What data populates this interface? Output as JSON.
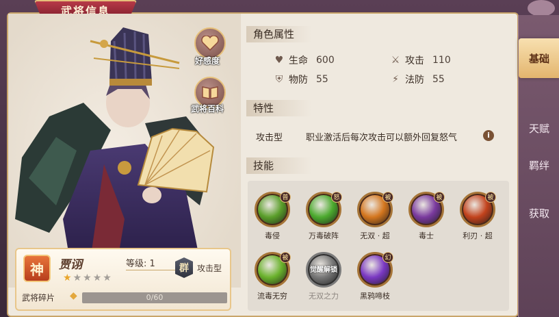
{
  "header": {
    "title": "武将信息"
  },
  "tabs": [
    {
      "label": "基础",
      "active": true
    },
    {
      "label": "天赋",
      "active": false
    },
    {
      "label": "羁绊",
      "active": false
    },
    {
      "label": "获取",
      "active": false
    }
  ],
  "side_buttons": {
    "favor_label": "好感度",
    "encyclopedia_label": "武将百科"
  },
  "hero": {
    "rank_badge": "神",
    "name": "贾诩",
    "level_text": "等级: 1",
    "faction_badge": "群",
    "type": "攻击型",
    "stars_filled": 1,
    "stars_total": 5,
    "star_glyph": "★"
  },
  "fragments": {
    "label": "武将碎片",
    "progress_text": "0/60",
    "current": 0,
    "required": 60
  },
  "attributes": {
    "heading": "角色属性",
    "hp_label": "生命",
    "hp_value": "600",
    "atk_label": "攻击",
    "atk_value": "110",
    "pdef_label": "物防",
    "pdef_value": "55",
    "mdef_label": "法防",
    "mdef_value": "55"
  },
  "trait": {
    "heading": "特性",
    "type": "攻击型",
    "description": "职业激活后每次攻击可以额外回复怒气",
    "info_glyph": "i"
  },
  "skills": {
    "heading": "技能",
    "items": [
      {
        "name": "毒侵",
        "badge": "普",
        "locked": false,
        "color": "#5a9e2a"
      },
      {
        "name": "万毒破阵",
        "badge": "怒",
        "locked": false,
        "color": "#4caa2e"
      },
      {
        "name": "无双 · 超",
        "badge": "被",
        "locked": false,
        "color": "#d4761e"
      },
      {
        "name": "毒士",
        "badge": "被",
        "locked": false,
        "color": "#7a3a9e"
      },
      {
        "name": "利刃 · 超",
        "badge": "被",
        "locked": false,
        "color": "#c2421c"
      },
      {
        "name": "流毒无穷",
        "badge": "被",
        "locked": false,
        "color": "#6ab22c"
      },
      {
        "name": "无双之力",
        "badge": "",
        "locked": true,
        "lock_text": "觉醒解锁",
        "color": "#7a7672"
      },
      {
        "name": "黑鸦啼枝",
        "badge": "幻",
        "locked": false,
        "color": "#7a38c2"
      }
    ]
  },
  "colors": {
    "accent_gold": "#e6c07a",
    "banner_red": "#b73a48",
    "tab_active": "#e3b56e",
    "panel_bg": "#efe9df"
  }
}
